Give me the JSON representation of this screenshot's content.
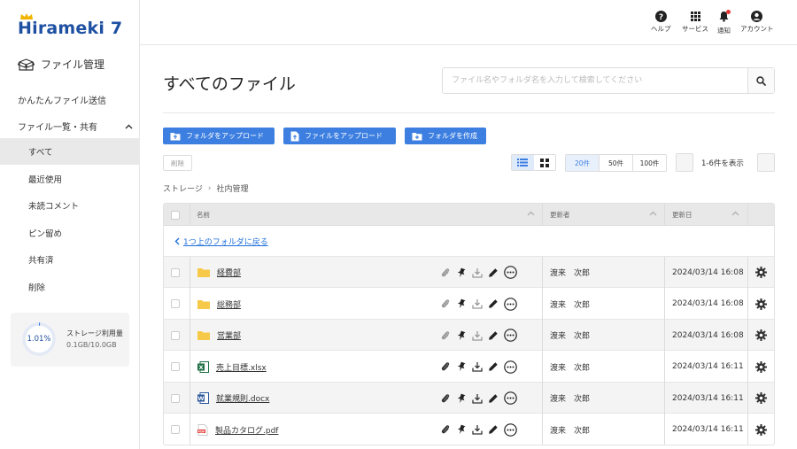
{
  "brand": {
    "logo_text": "Hirameki 7",
    "accent": "#3d7fe0",
    "brand_color": "#1e50a2"
  },
  "sidebar": {
    "file_mgmt": "ファイル管理",
    "easy_send": "かんたんファイル送信",
    "group_label": "ファイル一覧・共有",
    "items": [
      {
        "label": "すべて",
        "active": true
      },
      {
        "label": "最近使用"
      },
      {
        "label": "未読コメント"
      },
      {
        "label": "ピン留め"
      },
      {
        "label": "共有済"
      },
      {
        "label": "削除"
      }
    ],
    "storage": {
      "percent": "1.01%",
      "label": "ストレージ利用量",
      "value": "0.1GB/10.0GB",
      "fraction": 0.0101
    }
  },
  "header": {
    "help": "ヘルプ",
    "services": "サービス",
    "notifications": "通知",
    "account": "アカウント"
  },
  "main": {
    "title": "すべてのファイル",
    "search_placeholder": "ファイル名やフォルダ名を入力して検索してください",
    "upload_folder": "フォルダをアップロード",
    "upload_file": "ファイルをアップロード",
    "create_folder": "フォルダを作成",
    "delete": "削除",
    "per_page": [
      "20件",
      "50件",
      "100件"
    ],
    "per_page_selected": "20件",
    "range": "1-6件を表示",
    "breadcrumb": [
      "ストレージ",
      "社内管理"
    ]
  },
  "table": {
    "col_name": "名前",
    "col_updater": "更新者",
    "col_updated": "更新日",
    "parent_link": "1つ上のフォルダに戻る",
    "rows": [
      {
        "name": "経費部",
        "type": "folder",
        "updater": "渡来　次郎",
        "date": "2024/03/14 16:08"
      },
      {
        "name": "総務部",
        "type": "folder",
        "updater": "渡来　次郎",
        "date": "2024/03/14 16:08"
      },
      {
        "name": "営業部",
        "type": "folder",
        "updater": "渡来　次郎",
        "date": "2024/03/14 16:08"
      },
      {
        "name": "売上目標.xlsx",
        "type": "excel",
        "updater": "渡来　次郎",
        "date": "2024/03/14 16:11"
      },
      {
        "name": "就業規則.docx",
        "type": "word",
        "updater": "渡来　次郎",
        "date": "2024/03/14 16:11"
      },
      {
        "name": "製品カタログ.pdf",
        "type": "pdf",
        "updater": "渡来　次郎",
        "date": "2024/03/14 16:11"
      }
    ]
  }
}
